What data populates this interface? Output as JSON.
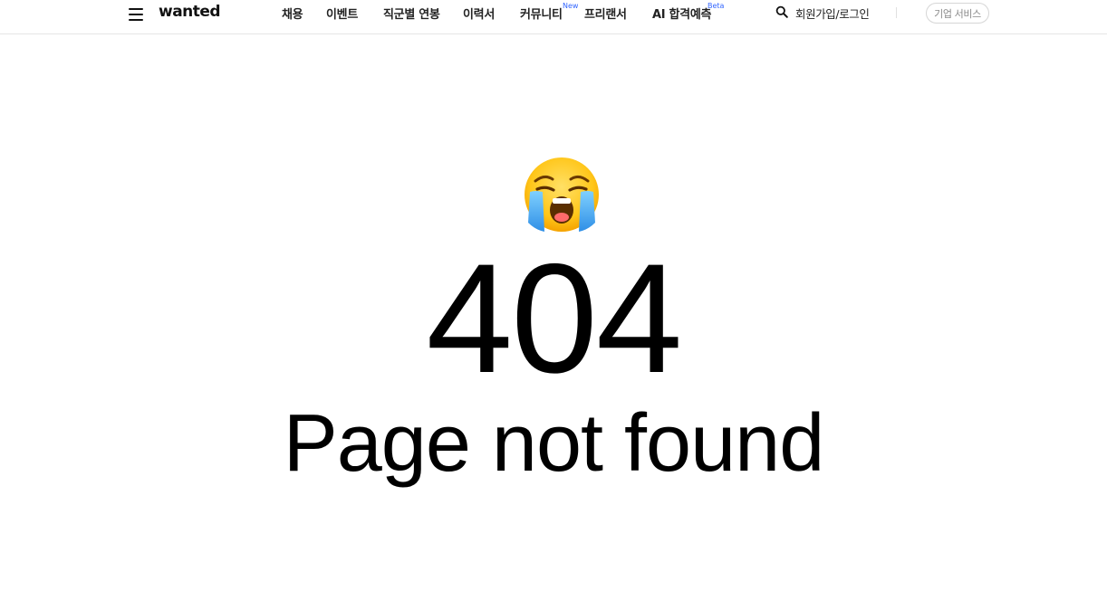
{
  "header": {
    "logo": "wanted",
    "nav": [
      {
        "label": "채용",
        "badge": ""
      },
      {
        "label": "이벤트",
        "badge": ""
      },
      {
        "label": "직군별 연봉",
        "badge": ""
      },
      {
        "label": "이력서",
        "badge": ""
      },
      {
        "label": "커뮤니티",
        "badge": "New"
      },
      {
        "label": "프리랜서",
        "badge": ""
      },
      {
        "label": "AI 합격예측",
        "badge": "Beta"
      }
    ],
    "login_label": "회원가입/로그인",
    "business_label": "기업 서비스"
  },
  "error": {
    "code": "404",
    "message": "Page not found"
  },
  "colors": {
    "badge": "#3366ff",
    "text": "#000000",
    "border": "#e6e6e6"
  }
}
